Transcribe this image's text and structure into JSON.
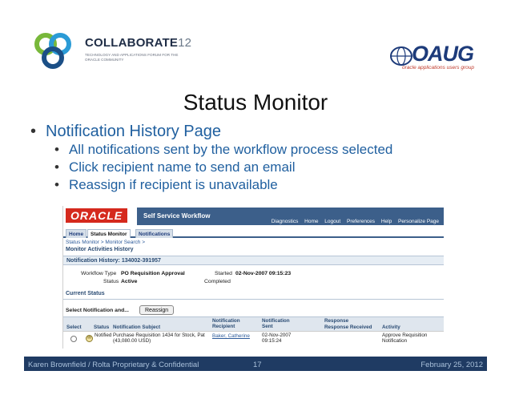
{
  "header": {
    "collab_title": "COLLABORATE",
    "collab_num": "12",
    "collab_sub": "TECHNOLOGY AND APPLICATIONS FORUM FOR THE ORACLE COMMUNITY",
    "oaug_word": "OAUG",
    "oaug_tag": "oracle applications users group"
  },
  "slide": {
    "title": "Status Monitor",
    "bullet_main": "Notification History Page",
    "sub_bullets": [
      "All notifications sent by the workflow process selected",
      "Click recipient name to send an email",
      "Reassign if recipient is unavailable"
    ]
  },
  "app": {
    "oracle": "ORACLE",
    "name": "Self Service Workflow",
    "global_links": [
      "Diagnostics",
      "Home",
      "Logout",
      "Preferences",
      "Help",
      "Personalize Page"
    ],
    "tabs": [
      "Home",
      "Status Monitor",
      "Notifications"
    ],
    "breadcrumb": "Status Monitor >    Monitor Search >",
    "page_heading": "Monitor Activities History",
    "section_heading": "Notification History: 134002-391957",
    "workflow_type_label": "Workflow Type",
    "workflow_type_value": "PO Requisition Approval",
    "status_label": "Status",
    "status_value": "Active",
    "started_label": "Started",
    "started_value": "02-Nov-2007 09:15:23",
    "completed_label": "Completed",
    "current_status": "Current Status",
    "select_label": "Select Notification and...",
    "reassign_button": "Reassign",
    "columns": {
      "select": "Select",
      "status": "Status",
      "subject": "Notification Subject",
      "recipient": "Notification Recipient",
      "sent": "Notification Sent",
      "response_received": "Response Received",
      "response": "Response",
      "activity": "Activity"
    },
    "row": {
      "status": "Notified",
      "subject": "Purchase Requisition 1434 for Stock, Pat (43,080.00 USD)",
      "recipient": "Baker, Catherine",
      "sent": "02-Nov-2007 09:15:24",
      "activity": "Approve Requisition Notification"
    }
  },
  "footer": {
    "left": "Karen Brownfield  /  Rolta  Proprietary & Confidential",
    "page": "17",
    "date": "February 25, 2012"
  },
  "colors": {
    "footer_bg": "#1f3b63",
    "bullet_blue": "#1f5f9f",
    "oracle_red": "#d5291d",
    "app_band": "#3c5f8a"
  }
}
